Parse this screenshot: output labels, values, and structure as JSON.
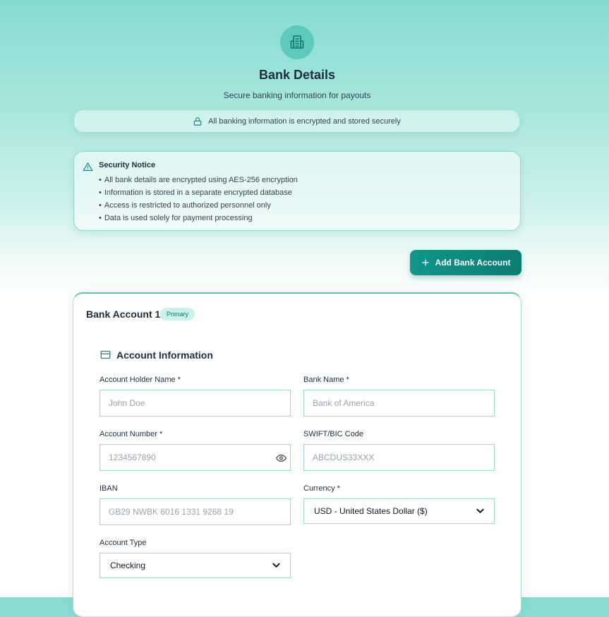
{
  "header": {
    "icon": "building-icon",
    "title": "Bank Details",
    "subtitle": "Secure banking information for payouts"
  },
  "encryption_banner": {
    "icon": "lock-icon",
    "text": "All banking information is encrypted and stored securely"
  },
  "security_notice": {
    "icon": "warning-triangle-icon",
    "title": "Security Notice",
    "items": [
      "All bank details are encrypted using AES-256 encryption",
      "Information is stored in a separate encrypted database",
      "Access is restricted to authorized personnel only",
      "Data is used solely for payment processing"
    ]
  },
  "add_button": {
    "icon": "plus-icon",
    "label": "Add Bank Account"
  },
  "account": {
    "title": "Bank Account 1",
    "badge": "Primary",
    "section": {
      "icon": "credit-card-icon",
      "title": "Account Information"
    },
    "fields": {
      "holder_name": {
        "label": "Account Holder Name *",
        "placeholder": "John Doe",
        "value": ""
      },
      "bank_name": {
        "label": "Bank Name *",
        "placeholder": "Bank of America",
        "value": ""
      },
      "account_number": {
        "label": "Account Number *",
        "placeholder": "1234567890",
        "value": "",
        "toggle_icon": "eye-icon"
      },
      "swift": {
        "label": "SWIFT/BIC Code",
        "placeholder": "ABCDUS33XXX",
        "value": ""
      },
      "iban": {
        "label": "IBAN",
        "placeholder": "GB29 NWBK 6016 1331 9268 19",
        "value": ""
      },
      "currency": {
        "label": "Currency *",
        "selected": "USD - United States Dollar ($)"
      },
      "account_type": {
        "label": "Account Type",
        "selected": "Checking"
      }
    }
  },
  "colors": {
    "accent": "#0f8f83",
    "button_start": "#12968a",
    "button_end": "#0b7c72",
    "border": "#99d9cf",
    "badge_bg": "#c8f2ea"
  }
}
